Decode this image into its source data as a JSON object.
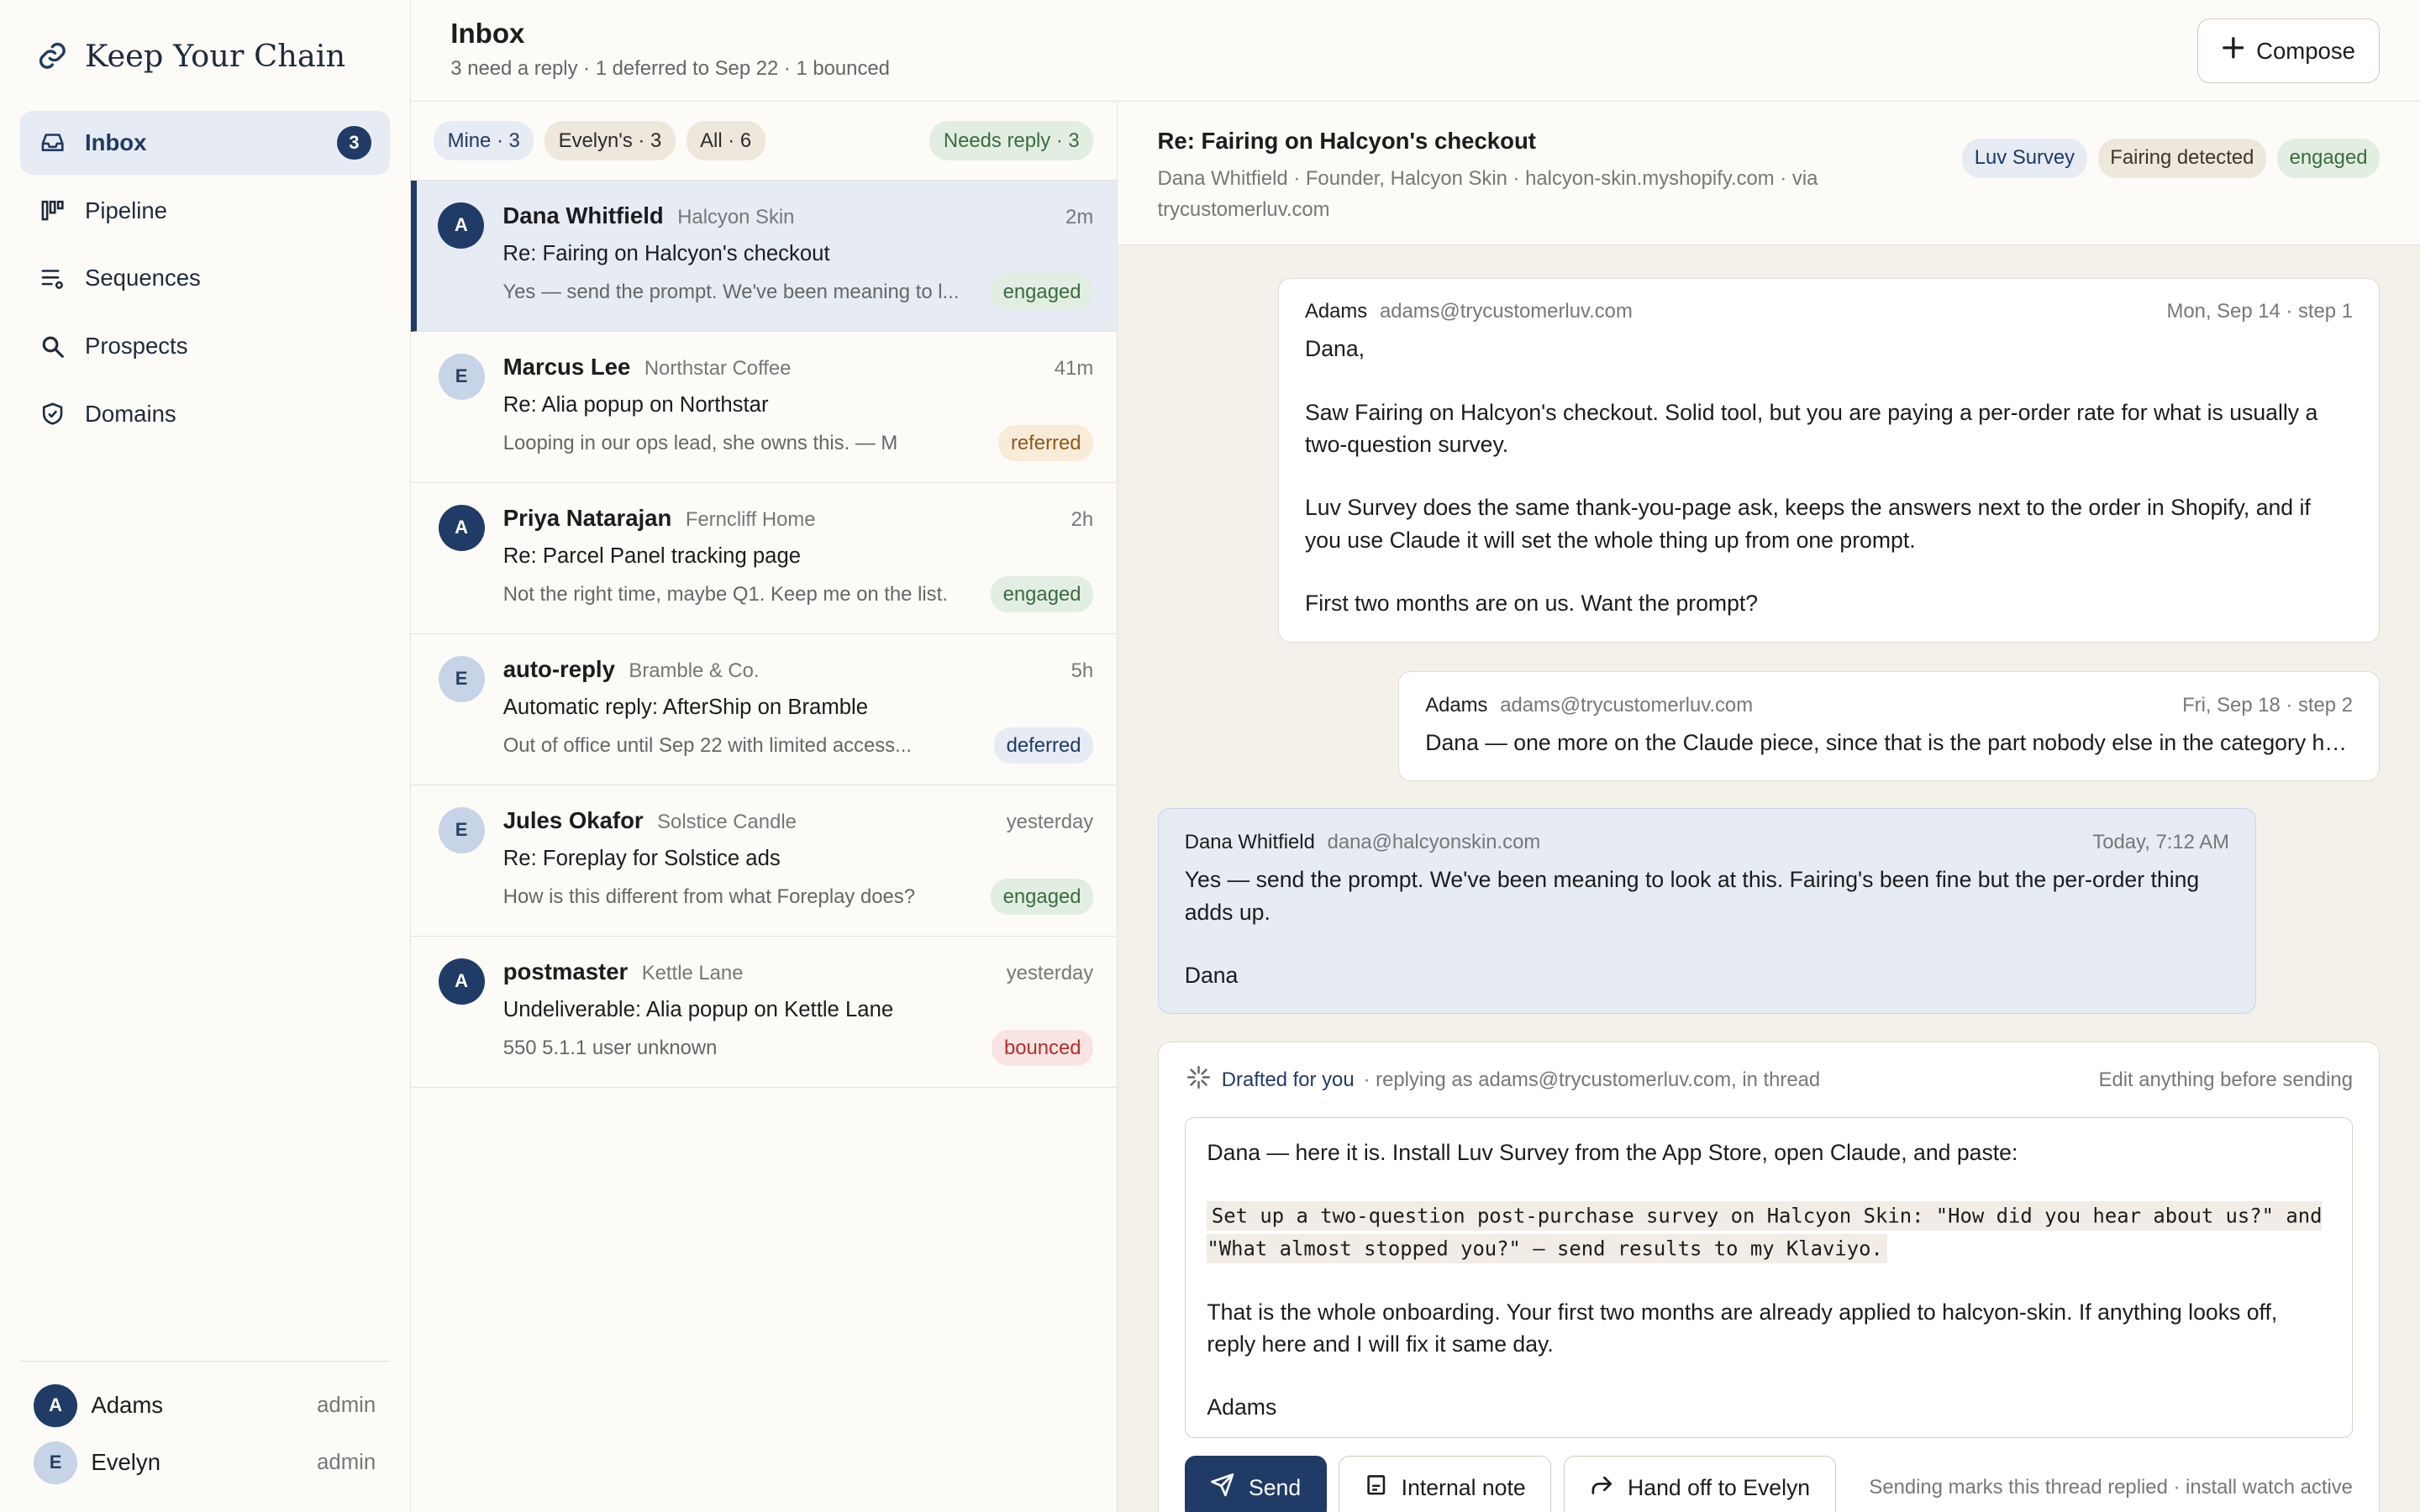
{
  "brand": {
    "name": "Keep Your Chain",
    "icon": "link-icon"
  },
  "nav": [
    {
      "label": "Inbox",
      "icon": "inbox-icon",
      "count": "3",
      "active": true
    },
    {
      "label": "Pipeline",
      "icon": "pipeline-icon"
    },
    {
      "label": "Sequences",
      "icon": "sequences-icon"
    },
    {
      "label": "Prospects",
      "icon": "search-icon"
    },
    {
      "label": "Domains",
      "icon": "shield-icon"
    }
  ],
  "users": [
    {
      "initial": "A",
      "name": "Adams",
      "role": "admin"
    },
    {
      "initial": "E",
      "name": "Evelyn",
      "role": "admin"
    }
  ],
  "header": {
    "title": "Inbox",
    "subtitle": "3 need a reply · 1 deferred to Sep 22 · 1 bounced",
    "compose_label": "Compose"
  },
  "filters": {
    "mine": "Mine · 3",
    "evelyn": "Evelyn's · 3",
    "all": "All · 6",
    "needs_reply": "Needs reply · 3"
  },
  "threads": [
    {
      "initial": "A",
      "who": "Dana Whitfield",
      "company": "Halcyon Skin",
      "time": "2m",
      "subject": "Re: Fairing on Halcyon's checkout",
      "preview": "Yes — send the prompt. We've been meaning to l...",
      "tag": "engaged"
    },
    {
      "initial": "E",
      "who": "Marcus Lee",
      "company": "Northstar Coffee",
      "time": "41m",
      "subject": "Re: Alia popup on Northstar",
      "preview": "Looping in our ops lead, she owns this. — M",
      "tag": "referred"
    },
    {
      "initial": "A",
      "who": "Priya Natarajan",
      "company": "Ferncliff Home",
      "time": "2h",
      "subject": "Re: Parcel Panel tracking page",
      "preview": "Not the right time, maybe Q1. Keep me on the list.",
      "tag": "engaged"
    },
    {
      "initial": "E",
      "who": "auto-reply",
      "company": "Bramble & Co.",
      "time": "5h",
      "subject": "Automatic reply: AfterShip on Bramble",
      "preview": "Out of office until Sep 22 with limited access...",
      "tag": "deferred"
    },
    {
      "initial": "E",
      "who": "Jules Okafor",
      "company": "Solstice Candle",
      "time": "yesterday",
      "subject": "Re: Foreplay for Solstice ads",
      "preview": "How is this different from what Foreplay does?",
      "tag": "engaged"
    },
    {
      "initial": "A",
      "who": "postmaster",
      "company": "Kettle Lane",
      "time": "yesterday",
      "subject": "Undeliverable: Alia popup on Kettle Lane",
      "preview": "550 5.1.1 user unknown",
      "tag": "bounced"
    }
  ],
  "detail": {
    "title": "Re: Fairing on Halcyon's checkout",
    "meta": "Dana Whitfield · Founder, Halcyon Skin · halcyon-skin.myshopify.com · via trycustomerluv.com",
    "tags": [
      "Luv Survey",
      "Fairing detected",
      "engaged"
    ]
  },
  "messages": [
    {
      "from": "Adams",
      "addr": "adams@trycustomerluv.com",
      "when": "Mon, Sep 14 · step 1",
      "body": [
        "Dana,",
        "Saw Fairing on Halcyon's checkout. Solid tool, but you are paying a per-order rate for what is usually a two-question survey.",
        "Luv Survey does the same thank-you-page ask, keeps the answers next to the order in Shopify, and if you use Claude it will set the whole thing up from one prompt.",
        "First two months are on us. Want the prompt?"
      ]
    },
    {
      "from": "Adams",
      "addr": "adams@trycustomerluv.com",
      "when": "Fri, Sep 18 · step 2",
      "body": [
        "Dana — one more on the Claude piece, since that is the part nobody else in the category has..."
      ]
    },
    {
      "from": "Dana Whitfield",
      "addr": "dana@halcyonskin.com",
      "when": "Today, 7:12 AM",
      "body": [
        "Yes — send the prompt. We've been meaning to look at this. Fairing's been fine but the per-order thing adds up.",
        "Dana"
      ]
    }
  ],
  "draft": {
    "label": "Drafted for you",
    "context": "· replying as adams@trycustomerluv.com, in thread",
    "edit_hint": "Edit anything before sending",
    "line1": "Dana — here it is. Install Luv Survey from the App Store, open Claude, and paste:",
    "code": "Set up a two-question post-purchase survey on Halcyon Skin: \"How did you hear about us?\" and \"What almost stopped you?\" — send results to my Klaviyo.",
    "line3": "That is the whole onboarding. Your first two months are already applied to halcyon-skin. If anything looks off, reply here and I will fix it same day.",
    "sign": "Adams",
    "send_label": "Send",
    "note_label": "Internal note",
    "handoff_label": "Hand off to Evelyn",
    "footer_hint": "Sending marks this thread replied · install watch active"
  }
}
